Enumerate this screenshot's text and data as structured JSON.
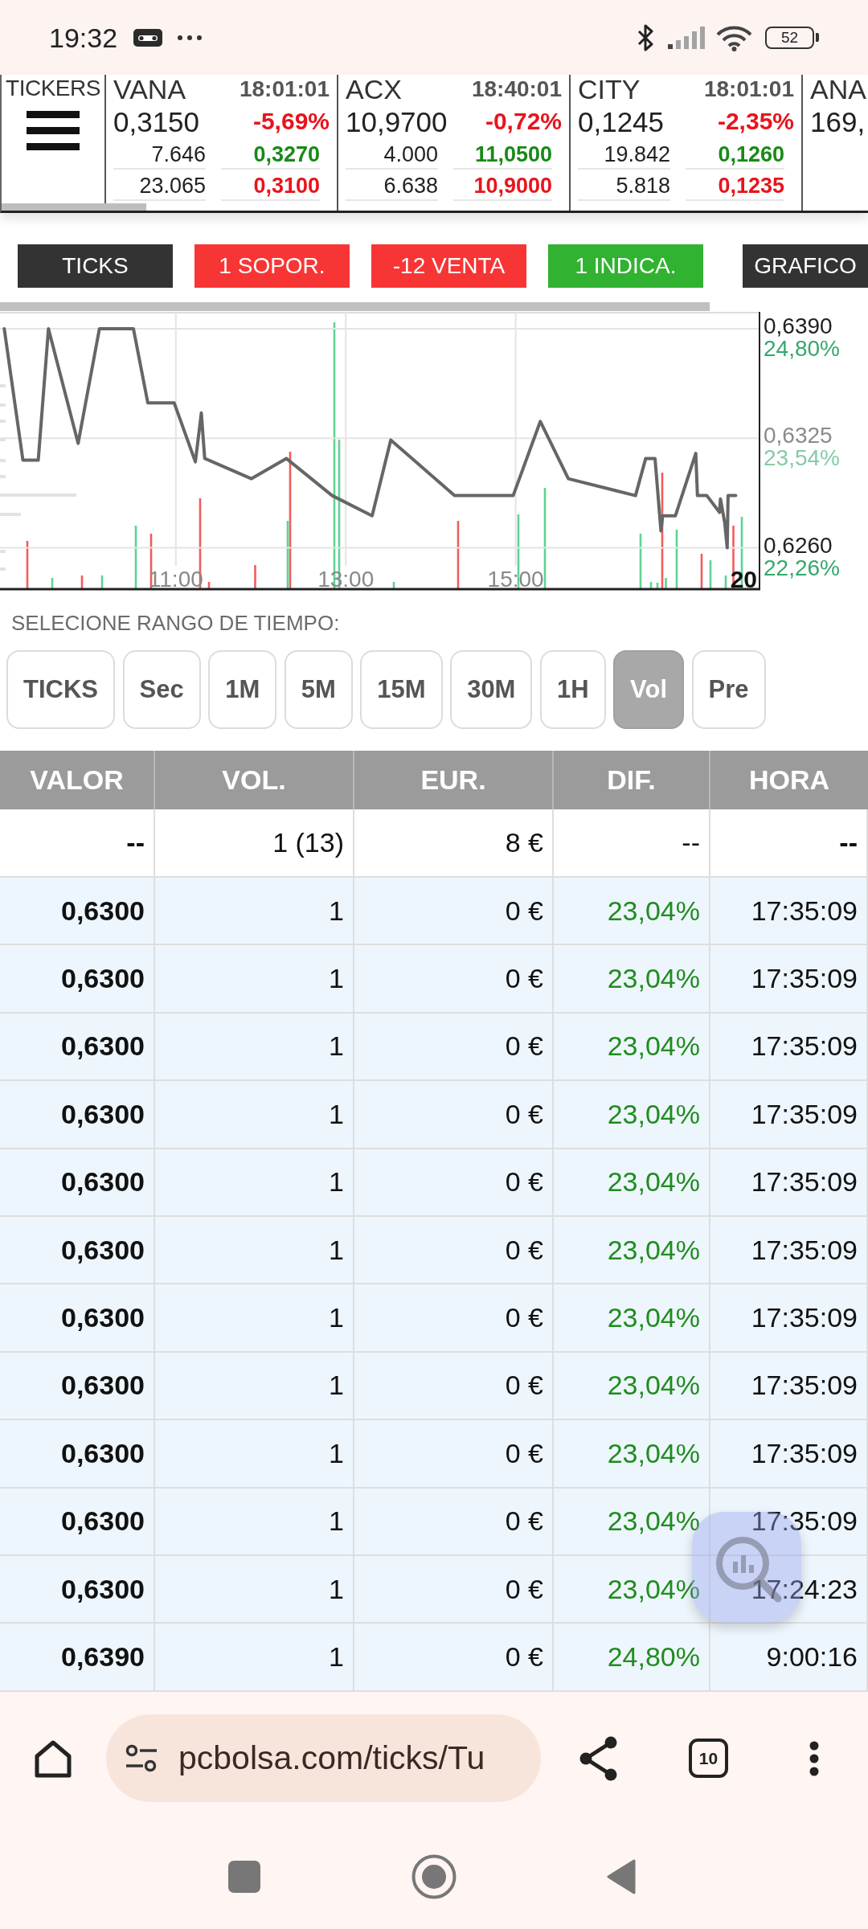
{
  "status_bar": {
    "time": "19:32",
    "battery": "52"
  },
  "tickers_panel": {
    "label": "TICKERS",
    "tickers": [
      {
        "symbol": "VANA",
        "time": "18:01:01",
        "price": "0,3150",
        "change": "-5,69%",
        "falling": true,
        "upper_volume": "7.646",
        "upper_price": "0,3270",
        "lower_volume": "23.065",
        "lower_price": "0,3100"
      },
      {
        "symbol": "ACX",
        "time": "18:40:01",
        "price": "10,9700",
        "change": "-0,72%",
        "falling": true,
        "upper_volume": "4.000",
        "upper_price": "11,0500",
        "lower_volume": "6.638",
        "lower_price": "10,9000"
      },
      {
        "symbol": "CITY",
        "time": "18:01:01",
        "price": "0,1245",
        "change": "-2,35%",
        "falling": true,
        "upper_volume": "19.842",
        "upper_price": "0,1260",
        "lower_volume": "5.818",
        "lower_price": "0,1235"
      },
      {
        "symbol": "ANA",
        "price": "169,"
      }
    ]
  },
  "signal_buttons": [
    {
      "label": "TICKS",
      "color": "#333333"
    },
    {
      "label": "1 SOPOR.",
      "color": "#f83535"
    },
    {
      "label": "-12 VENTA",
      "color": "#f83535"
    },
    {
      "label": "1 INDICA.",
      "color": "#31b231"
    },
    {
      "label": "GRAFICO",
      "color": "#333333"
    }
  ],
  "chart": {
    "percent_labels": [
      "24,80%",
      "23,54%",
      "22,26%"
    ],
    "chart_data": {
      "type": "line",
      "x": [
        8.98,
        9.2,
        9.38,
        9.5,
        9.85,
        10.1,
        10.5,
        10.67,
        10.98,
        11.23,
        11.3,
        11.34,
        11.89,
        12.3,
        12.84,
        13.31,
        13.53,
        14.28,
        14.97,
        15.29,
        15.62,
        16.41,
        16.53,
        16.64,
        16.71,
        16.73,
        16.88,
        17.12,
        17.14,
        17.25,
        17.4,
        17.41,
        17.46,
        17.49,
        17.5,
        17.59
      ],
      "values": [
        0.639,
        0.6312,
        0.6312,
        0.639,
        0.6322,
        0.639,
        0.639,
        0.6346,
        0.6346,
        0.6311,
        0.634,
        0.6313,
        0.6301,
        0.6313,
        0.6291,
        0.6279,
        0.6324,
        0.6291,
        0.6291,
        0.6335,
        0.6301,
        0.6291,
        0.6313,
        0.6313,
        0.627,
        0.6279,
        0.6279,
        0.6316,
        0.6291,
        0.6291,
        0.6281,
        0.6289,
        0.6275,
        0.626,
        0.6291,
        0.6291
      ],
      "xlim": [
        8.93,
        17.87
      ],
      "ylim": [
        0.6235,
        0.64
      ],
      "xticks": [
        {
          "value": 11,
          "label": "11:00"
        },
        {
          "value": 13,
          "label": "13:00"
        },
        {
          "value": 15,
          "label": "15:00"
        }
      ],
      "yticks": [
        {
          "value": 0.639,
          "label": "0,6390"
        },
        {
          "value": 0.6325,
          "label": "0,6325"
        },
        {
          "value": 0.626,
          "label": "0,6260"
        }
      ],
      "grid": true,
      "annotations": [
        "20"
      ]
    }
  },
  "time_range": {
    "label": "SELECIONE RANGO DE TIEMPO:",
    "options": [
      {
        "label": "TICKS",
        "selected": false
      },
      {
        "label": "Sec",
        "selected": false
      },
      {
        "label": "1M",
        "selected": false
      },
      {
        "label": "5M",
        "selected": false
      },
      {
        "label": "15M",
        "selected": false
      },
      {
        "label": "30M",
        "selected": false
      },
      {
        "label": "1H",
        "selected": false
      },
      {
        "label": "Vol",
        "selected": true
      },
      {
        "label": "Pre",
        "selected": false
      }
    ]
  },
  "table": {
    "columns": [
      "VALOR",
      "VOL.",
      "EUR.",
      "DIF.",
      "HORA"
    ],
    "rows": [
      {
        "kind": "summary",
        "cells": [
          "--",
          "1 (13)",
          "8 €",
          "--",
          "--"
        ]
      },
      {
        "kind": "trade",
        "cells": [
          "0,6300",
          "1",
          "0 €",
          "23,04%",
          "17:35:09"
        ]
      },
      {
        "kind": "trade",
        "cells": [
          "0,6300",
          "1",
          "0 €",
          "23,04%",
          "17:35:09"
        ]
      },
      {
        "kind": "trade",
        "cells": [
          "0,6300",
          "1",
          "0 €",
          "23,04%",
          "17:35:09"
        ]
      },
      {
        "kind": "trade",
        "cells": [
          "0,6300",
          "1",
          "0 €",
          "23,04%",
          "17:35:09"
        ]
      },
      {
        "kind": "trade",
        "cells": [
          "0,6300",
          "1",
          "0 €",
          "23,04%",
          "17:35:09"
        ]
      },
      {
        "kind": "trade",
        "cells": [
          "0,6300",
          "1",
          "0 €",
          "23,04%",
          "17:35:09"
        ]
      },
      {
        "kind": "trade",
        "cells": [
          "0,6300",
          "1",
          "0 €",
          "23,04%",
          "17:35:09"
        ]
      },
      {
        "kind": "trade",
        "cells": [
          "0,6300",
          "1",
          "0 €",
          "23,04%",
          "17:35:09"
        ]
      },
      {
        "kind": "trade",
        "cells": [
          "0,6300",
          "1",
          "0 €",
          "23,04%",
          "17:35:09"
        ]
      },
      {
        "kind": "trade",
        "cells": [
          "0,6300",
          "1",
          "0 €",
          "23,04%",
          "17:35:09"
        ]
      },
      {
        "kind": "trade",
        "cells": [
          "0,6300",
          "1",
          "0 €",
          "23,04%",
          "17:24:23"
        ]
      },
      {
        "kind": "trade",
        "cells": [
          "0,6390",
          "1",
          "0 €",
          "24,80%",
          "9:00:16"
        ]
      }
    ]
  },
  "browser": {
    "url": "pcbolsa.com/ticks/Tu",
    "tab_count": "10"
  }
}
